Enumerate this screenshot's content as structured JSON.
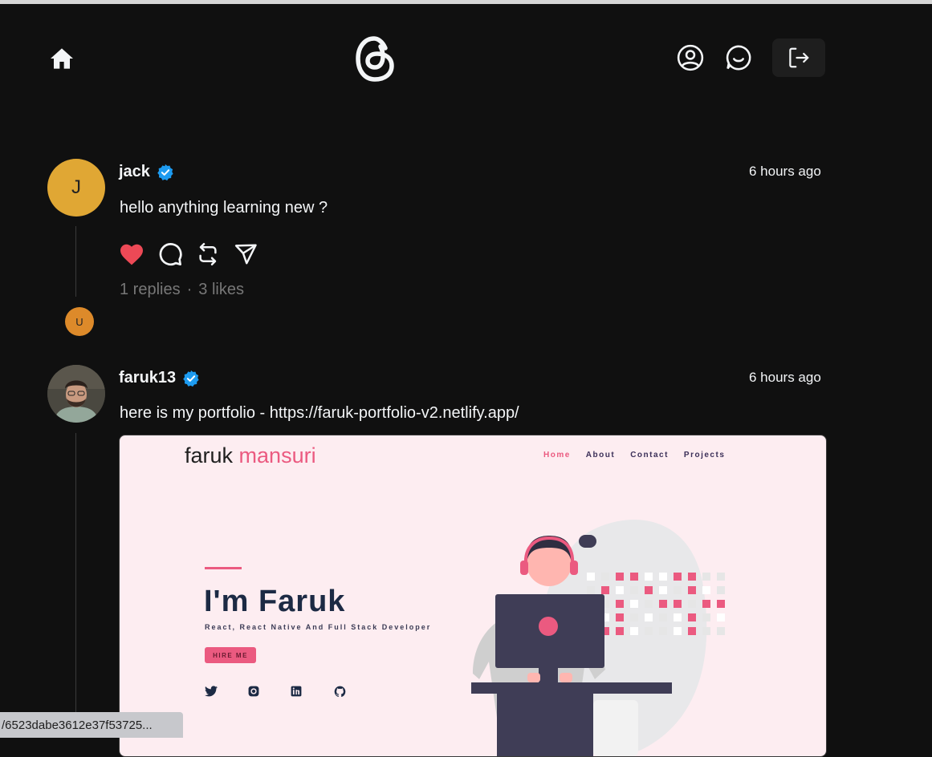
{
  "header": {
    "icons": [
      "home-icon",
      "threads-logo-icon",
      "user-profile-icon",
      "chat-icon",
      "logout-icon"
    ]
  },
  "posts": [
    {
      "avatar_initial": "J",
      "username": "jack",
      "verified": true,
      "time": "6 hours ago",
      "text": "hello anything learning new ?",
      "replies": "1 replies",
      "likes": "3 likes",
      "liked": true,
      "reply_avatar_initial": "U"
    },
    {
      "username": "faruk13",
      "verified": true,
      "time": "6 hours ago",
      "text": "here is my portfolio - https://faruk-portfolio-v2.netlify.app/",
      "preview": {
        "logo_first": "faruk",
        "logo_second": "mansuri",
        "nav": [
          "Home",
          "About",
          "Contact",
          "Projects"
        ],
        "title": "I'm Faruk",
        "subtitle": "React, React Native And Full Stack Developer",
        "hire_button": "HIRE ME",
        "social_icons": [
          "twitter-icon",
          "instagram-icon",
          "linkedin-icon",
          "github-icon"
        ]
      }
    }
  ],
  "status_bar": {
    "url": "/6523dabe3612e37f53725..."
  },
  "colors": {
    "background": "#101010",
    "like": "#ed4956",
    "verified": "#1d9bf0",
    "accent_pink": "#eb5a80"
  }
}
